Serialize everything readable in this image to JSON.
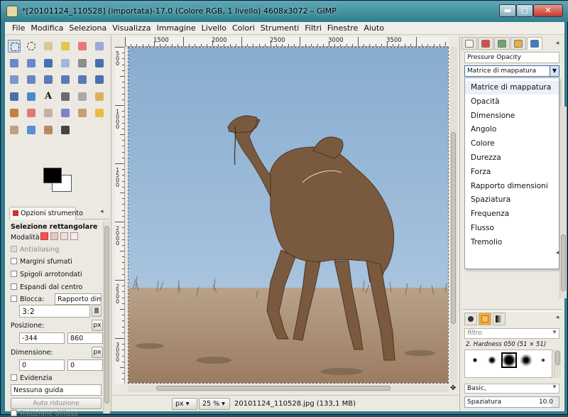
{
  "window": {
    "title": "*[20101124_110528] (importata)-17.0 (Colore RGB, 1 livello) 4608x3072 – GIMP",
    "min_glyph": "▬",
    "max_glyph": "▢",
    "close_glyph": "✕"
  },
  "menu": [
    "File",
    "Modifica",
    "Seleziona",
    "Visualizza",
    "Immagine",
    "Livello",
    "Colori",
    "Strumenti",
    "Filtri",
    "Finestre",
    "Aiuto"
  ],
  "toolbox": {
    "tool_icons": [
      "rect-select-icon",
      "ellipse-select-icon",
      "free-select-icon",
      "fuzzy-select-icon",
      "color-select-icon",
      "scissors-icon",
      "foreground-select-icon",
      "paths-icon",
      "color-picker-icon",
      "zoom-icon",
      "measure-icon",
      "move-icon",
      "align-icon",
      "crop-icon",
      "rotate-icon",
      "scale-icon",
      "shear-icon",
      "perspective-icon",
      "flip-icon",
      "cage-icon",
      "text-icon",
      "bucket-fill-icon",
      "blend-icon",
      "pencil-icon",
      "paintbrush-icon",
      "eraser-icon",
      "airbrush-icon",
      "ink-icon",
      "clone-icon",
      "heal-icon",
      "perspective-clone-icon",
      "blur-icon",
      "smudge-icon",
      "dodge-burn-icon"
    ],
    "tab_label": "Opzioni strumento",
    "tab_menu_glyph": "◂",
    "tool_name": "Selezione rettangolare",
    "mode_label": "Modalità:",
    "antialias_label": "Antialiasing",
    "feather_label": "Margini sfumati",
    "rounded_label": "Spigoli arrotondati",
    "expand_label": "Espandi dal centro",
    "fixed_label": "Blocca:",
    "fixed_value": "Rapporto dimensioni",
    "ratio_value": "3:2",
    "position_label": "Posizione:",
    "position_unit": "px",
    "pos_x": "-344",
    "pos_y": "860",
    "size_label": "Dimensione:",
    "size_unit": "px",
    "size_w": "0",
    "size_h": "0",
    "highlight_label": "Evidenzia",
    "guide_value": "Nessuna guida",
    "autoshrink_label": "Auto riduzione",
    "merge_label": "Riduzione diffusa"
  },
  "rulers": {
    "h_labels": [
      "1500",
      "2000",
      "2500",
      "3000",
      "3500"
    ],
    "v_labels": [
      "500",
      "1000",
      "1500",
      "2000",
      "2500",
      "3000"
    ]
  },
  "status": {
    "unit": "px",
    "zoom": "25 %",
    "file": "20101124_110528.jpg (133,1 MB)"
  },
  "dock": {
    "tab_icons": [
      "document-icon",
      "layers-icon",
      "channels-icon",
      "undo-icon",
      "paint-dynamics-icon"
    ],
    "dynamics_title": "Pressure Opacity",
    "mapping_selected": "Matrice di mappatura",
    "mapping_options": [
      "Matrice di mappatura",
      "Opacità",
      "Dimensione",
      "Angolo",
      "Colore",
      "Durezza",
      "Forza",
      "Rapporto dimensioni",
      "Spaziatura",
      "Frequenza",
      "Flusso",
      "Tremolio"
    ],
    "brush_filter_placeholder": "filtro",
    "brush_name": "2. Hardness 050 (51 × 51)",
    "brush_preset": "Basic,",
    "spacing_label": "Spaziatura",
    "spacing_value": "10.0"
  },
  "colors": {
    "accent": "#3d6fb1",
    "sky": "#8fb3d4",
    "sand": "#b49a7c"
  }
}
